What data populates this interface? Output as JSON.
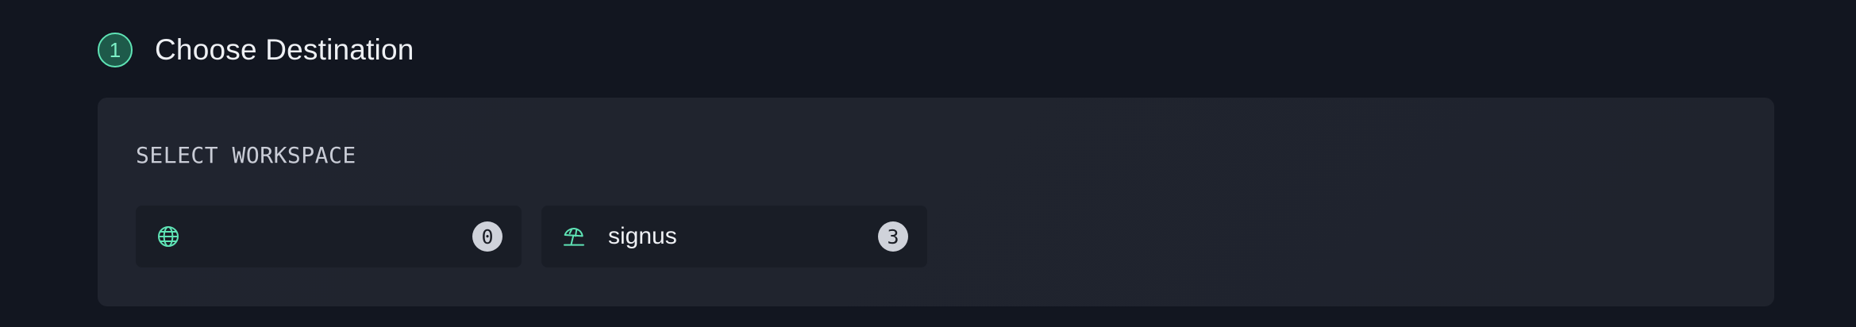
{
  "step": {
    "number": "1",
    "title": "Choose Destination"
  },
  "workspace_section": {
    "label": "SELECT WORKSPACE",
    "items": [
      {
        "icon": "globe-icon",
        "name": "",
        "count": "0"
      },
      {
        "icon": "beach-umbrella-icon",
        "name": "signus",
        "count": "3"
      }
    ]
  },
  "colors": {
    "accent": "#5fe3b5",
    "background": "#121620",
    "card": "#20242f",
    "item": "#191d26",
    "badge": "#cfd2da"
  }
}
